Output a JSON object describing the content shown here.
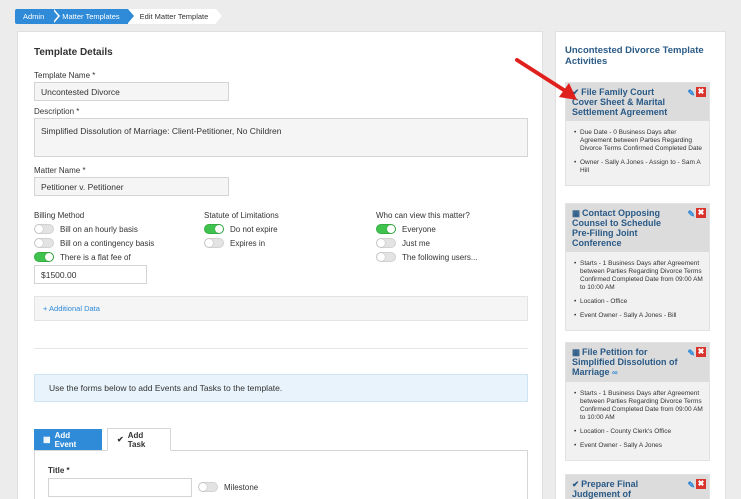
{
  "breadcrumb": [
    "Admin",
    "Matter Templates",
    "Edit Matter Template"
  ],
  "details": {
    "title": "Template Details",
    "template_name_label": "Template Name *",
    "template_name": "Uncontested Divorce",
    "description_label": "Description *",
    "description": "Simplified Dissolution of Marriage:  Client-Petitioner, No Children",
    "matter_name_label": "Matter Name *",
    "matter_name": "Petitioner v. Petitioner"
  },
  "billing": {
    "label": "Billing Method",
    "options": [
      {
        "label": "Bill on an hourly basis",
        "on": false
      },
      {
        "label": "Bill on a contingency basis",
        "on": false
      },
      {
        "label": "There is a flat fee of",
        "on": true
      }
    ],
    "flat_fee": "$1500.00"
  },
  "statute": {
    "label": "Statute of Limitations",
    "options": [
      {
        "label": "Do not expire",
        "on": true
      },
      {
        "label": "Expires in",
        "on": false
      }
    ]
  },
  "visibility": {
    "label": "Who can view this matter?",
    "options": [
      {
        "label": "Everyone",
        "on": true
      },
      {
        "label": "Just me",
        "on": false
      },
      {
        "label": "The following users...",
        "on": false
      }
    ]
  },
  "additional_data": "+ Additional Data",
  "info_text": "Use the forms below to add Events and Tasks to the template.",
  "tabs": {
    "event": "Add Event",
    "task": "Add Task"
  },
  "task_form": {
    "title_label": "Title *",
    "title_value": "",
    "milestone_label": "Milestone"
  },
  "sidebar": {
    "title": "Uncontested Divorce Template Activities",
    "cards": [
      {
        "icon": "checkmark-icon",
        "title": "File Family Court Cover Sheet & Marital Settlement Agreement",
        "items": [
          "Due Date - 0 Business Days after Agreement between Parties Regarding Divorce Terms Confirmed Completed Date",
          "Owner - Sally A Jones - Assign to - Sam A Hill"
        ]
      },
      {
        "icon": "calendar-icon",
        "title": "Contact Opposing Counsel to Schedule Pre-Filing Joint Conference",
        "items": [
          "Starts - 1 Business Days after Agreement between Parties Regarding Divorce Terms Confirmed Completed Date from 09:00 AM to 10:00 AM",
          "Location - Office",
          "Event Owner - Sally A Jones - Bill"
        ]
      },
      {
        "icon": "calendar-icon",
        "title": "File Petition for Simplified Dissolution of Marriage",
        "items": [
          "Starts - 1 Business Days after Agreement between Parties Regarding Divorce Terms Confirmed Completed Date from 09:00 AM to 10:00 AM",
          "Location - County Clerk's Office",
          "Event Owner - Sally A Jones"
        ]
      },
      {
        "icon": "checkmark-icon",
        "title": "Prepare Final Judgement of",
        "items": []
      }
    ]
  },
  "colors": {
    "accent": "#2f8ad8",
    "heading": "#2a5a86",
    "toggle_on": "#3fc24e",
    "delete": "#d9342b",
    "annotation_arrow": "#e0201c"
  }
}
